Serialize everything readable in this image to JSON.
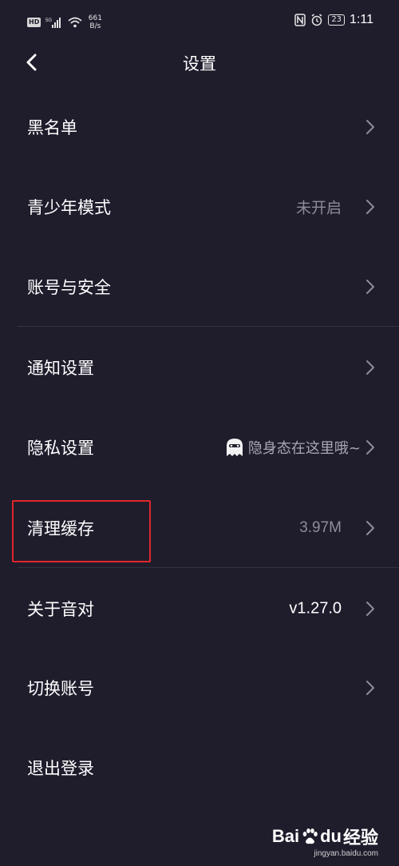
{
  "status_bar": {
    "hd": "HD",
    "network": "5G",
    "speed_value": "661",
    "speed_unit": "B/s",
    "battery": "23",
    "time": "1:11"
  },
  "nav": {
    "title": "设置",
    "back_icon": "chevron-left-icon"
  },
  "settings": [
    {
      "label": "黑名单",
      "value": ""
    },
    {
      "label": "青少年模式",
      "value": "未开启"
    },
    {
      "label": "账号与安全",
      "value": ""
    },
    {
      "label": "通知设置",
      "value": ""
    },
    {
      "label": "隐私设置",
      "value": "隐身态在这里哦~"
    },
    {
      "label": "清理缓存",
      "value": "3.97M"
    },
    {
      "label": "关于音对",
      "value": "v1.27.0"
    },
    {
      "label": "切换账号",
      "value": ""
    },
    {
      "label": "退出登录",
      "value": ""
    }
  ],
  "annotation": {
    "highlight_color": "#e0262b",
    "highlighted_item": "清理缓存"
  },
  "watermark": {
    "logo_left": "Bai",
    "logo_right": "du",
    "sub": "经验",
    "url": "jingyan.baidu.com"
  },
  "colors": {
    "background": "#1f1d2c",
    "text": "#ffffff",
    "secondary": "#8e8c9a",
    "divider": "#34323f"
  }
}
